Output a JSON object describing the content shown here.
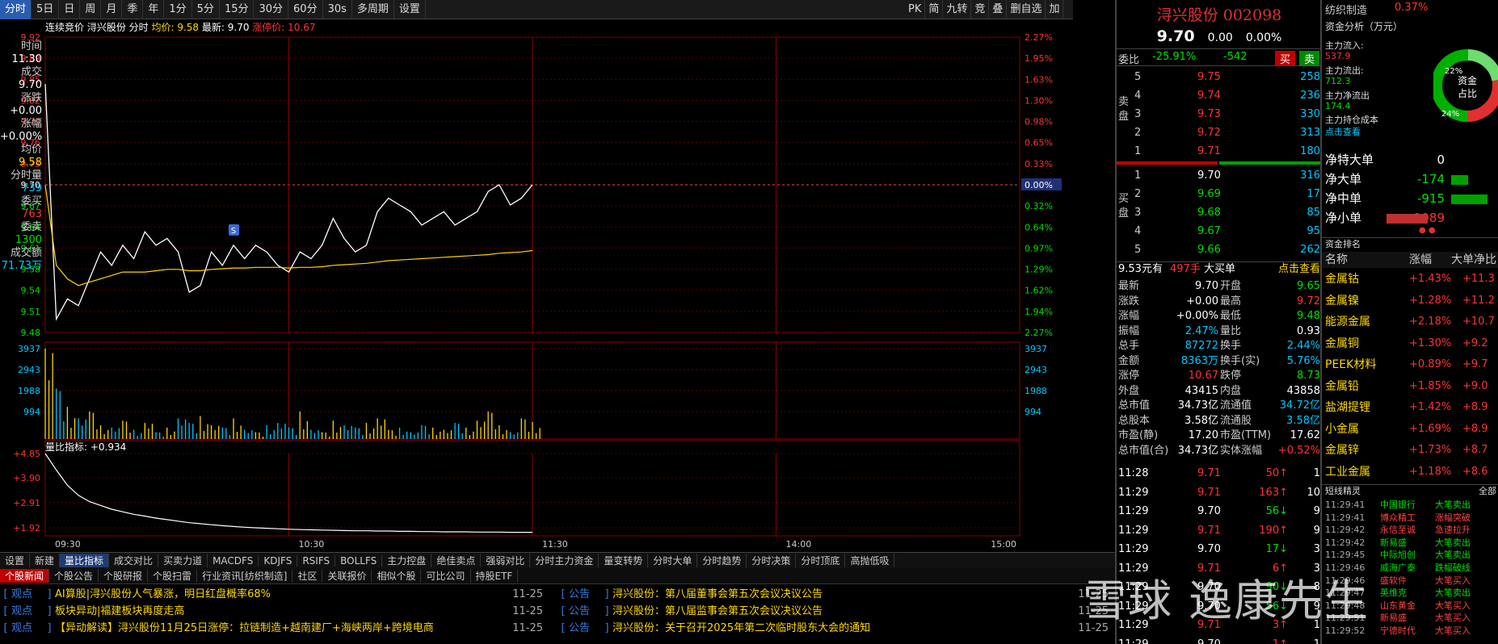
{
  "toolbar": {
    "items": [
      "分时",
      "5日",
      "日",
      "周",
      "月",
      "季",
      "年",
      "1分",
      "5分",
      "15分",
      "30分",
      "60分",
      "30s",
      "多周期",
      "设置"
    ],
    "right_items": [
      "PK",
      "简",
      "九转",
      "竞",
      "叠",
      "删自选",
      "加"
    ]
  },
  "chart_header": {
    "label_auction": "连续竞价",
    "stock": "浔兴股份",
    "mode": "分时",
    "avg_label": "均价: 9.58",
    "last_label": "最新: 9.70",
    "limit_label": "涨停价: 10.67"
  },
  "price_axis": [
    "9.92",
    "9.89",
    "9.85",
    "9.82",
    "9.79",
    "9.76",
    "9.73",
    "9.70",
    "9.67",
    "9.64",
    "9.61",
    "9.58",
    "9.54",
    "9.51",
    "9.48"
  ],
  "pct_axis": [
    "2.27%",
    "1.95%",
    "1.63%",
    "1.30%",
    "0.98%",
    "0.65%",
    "0.33%",
    "0.00%",
    "0.32%",
    "0.64%",
    "0.97%",
    "1.29%",
    "1.62%",
    "1.94%",
    "2.27%"
  ],
  "volume_axis": [
    "3937",
    "2943",
    "1988",
    "994"
  ],
  "liangbi_axis": [
    "+4.85",
    "+3.90",
    "+2.91",
    "+1.92"
  ],
  "liangbi_label": "量比指标: +0.934",
  "time_axis": [
    "09:30",
    "10:30",
    "11:30",
    "14:00",
    "15:00"
  ],
  "left_info": {
    "items": [
      {
        "label": "时间",
        "value": "11:30",
        "color": "#ffffff"
      },
      {
        "label": "成交",
        "value": "9.70",
        "color": "#ffffff"
      },
      {
        "label": "涨跌",
        "value": "+0.00",
        "color": "#ffffff"
      },
      {
        "label": "涨幅",
        "value": "+0.00%",
        "color": "#ffffff"
      },
      {
        "label": "均价",
        "value": "9.58",
        "color": "#ffd700"
      },
      {
        "label": "分时量",
        "value": "739",
        "color": "#00c8ff"
      },
      {
        "label": "委买",
        "value": "763",
        "color": "#ff3333"
      },
      {
        "label": "委卖",
        "value": "1300",
        "color": "#00e000"
      },
      {
        "label": "成交额",
        "value": "71.73万",
        "color": "#00c8ff"
      }
    ]
  },
  "chart_data": {
    "type": "line",
    "title": "浔兴股份 分时",
    "x_labels": [
      "09:30",
      "10:30",
      "11:30",
      "14:00",
      "15:00"
    ],
    "y_range": [
      9.48,
      9.92
    ],
    "pre_close": 9.7,
    "series": [
      {
        "name": "价格",
        "values": [
          9.85,
          9.5,
          9.53,
          9.52,
          9.56,
          9.6,
          9.58,
          9.61,
          9.59,
          9.63,
          9.61,
          9.62,
          9.6,
          9.54,
          9.55,
          9.6,
          9.58,
          9.61,
          9.59,
          9.61,
          9.6,
          9.58,
          9.57,
          9.6,
          9.59,
          9.61,
          9.65,
          9.62,
          9.6,
          9.61,
          9.66,
          9.68,
          9.67,
          9.66,
          9.64,
          9.65,
          9.66,
          9.64,
          9.65,
          9.66,
          9.69,
          9.7,
          9.67,
          9.68,
          9.7
        ]
      },
      {
        "name": "均价",
        "values": [
          9.7,
          9.58,
          9.56,
          9.55,
          9.555,
          9.56,
          9.565,
          9.57,
          9.57,
          9.57,
          9.572,
          9.574,
          9.574,
          9.572,
          9.572,
          9.574,
          9.575,
          9.576,
          9.576,
          9.577,
          9.577,
          9.577,
          9.576,
          9.577,
          9.577,
          9.578,
          9.58,
          9.581,
          9.582,
          9.583,
          9.585,
          9.587,
          9.588,
          9.589,
          9.59,
          9.591,
          9.592,
          9.593,
          9.594,
          9.595,
          9.596,
          9.598,
          9.599,
          9.6,
          9.602
        ]
      },
      {
        "name": "量比",
        "values": [
          4.85,
          4.2,
          3.6,
          3.2,
          2.95,
          2.8,
          2.65,
          2.55,
          2.45,
          2.38,
          2.3,
          2.24,
          2.18,
          2.12,
          2.08,
          2.04,
          2.0,
          1.97,
          1.94,
          1.92,
          1.9,
          1.88,
          1.86,
          1.85,
          1.84,
          1.83,
          1.82,
          1.81,
          1.8,
          1.8,
          1.79,
          1.79,
          1.78,
          1.78,
          1.77,
          1.77,
          1.76,
          1.76,
          1.76,
          1.75,
          1.75,
          1.75,
          1.74,
          1.74,
          1.74
        ]
      }
    ],
    "volumes": [
      3937,
      2200,
      1400,
      900,
      1200,
      600,
      500,
      800,
      400,
      700,
      300,
      500,
      900,
      700,
      1000,
      600,
      500,
      900,
      400,
      300,
      600,
      700,
      500,
      1200,
      400,
      300,
      800,
      600,
      500,
      700,
      900,
      400,
      500,
      300,
      600,
      500,
      400,
      700,
      500,
      800,
      1200,
      600,
      300,
      900,
      739
    ]
  },
  "bottom_tabs": [
    "设置",
    "新建",
    "量比指标",
    "成交对比",
    "买卖力道",
    "MACDFS",
    "KDJFS",
    "RSIFS",
    "BOLLFS",
    "主力控盘",
    "绝佳卖点",
    "强弱对比",
    "分时主力资金",
    "量变转势",
    "分时大单",
    "分时趋势",
    "分时决策",
    "分时顶底",
    "高抛低吸"
  ],
  "news_tabs": [
    "个股新闻",
    "个股公告",
    "个股研报",
    "个股扫雷",
    "行业资讯[纺织制造]",
    "社区",
    "关联报价",
    "相似个股",
    "可比公司",
    "持股ETF"
  ],
  "news_left": [
    {
      "cat": "观点",
      "title": "AI算股|浔兴股份人气暴涨，明日红盘概率68%",
      "date": "11-25"
    },
    {
      "cat": "观点",
      "title": "板块异动|福建板块再度走高",
      "date": "11-25"
    },
    {
      "cat": "观点",
      "title": "【异动解读】浔兴股份11月25日涨停：拉链制造+越南建厂+海峡两岸+跨境电商",
      "date": "11-25"
    }
  ],
  "news_right": [
    {
      "cat": "公告",
      "title": "浔兴股份：第八届董事会第五次会议决议公告",
      "date": "11-25"
    },
    {
      "cat": "公告",
      "title": "浔兴股份：第八届监事会第五次会议决议公告",
      "date": "11-25"
    },
    {
      "cat": "公告",
      "title": "浔兴股份：关于召开2025年第二次临时股东大会的通知",
      "date": "11-25"
    }
  ],
  "quote": {
    "name": "浔兴股份 002098",
    "price": "9.70",
    "change": "0.00",
    "change_pct": "0.00%",
    "weibi_label": "委比",
    "weibi": "-25.91%",
    "weicha": "-542",
    "buy_btn": "买",
    "sell_btn": "卖",
    "sell_label": "卖盘",
    "buy_label": "买盘",
    "asks": [
      {
        "lvl": "5",
        "price": "9.75",
        "vol": "258"
      },
      {
        "lvl": "4",
        "price": "9.74",
        "vol": "236"
      },
      {
        "lvl": "3",
        "price": "9.73",
        "vol": "330"
      },
      {
        "lvl": "2",
        "price": "9.72",
        "vol": "313"
      },
      {
        "lvl": "1",
        "price": "9.71",
        "vol": "180"
      }
    ],
    "bids": [
      {
        "lvl": "1",
        "price": "9.70",
        "vol": "316"
      },
      {
        "lvl": "2",
        "price": "9.69",
        "vol": "17"
      },
      {
        "lvl": "3",
        "price": "9.68",
        "vol": "85"
      },
      {
        "lvl": "4",
        "price": "9.67",
        "vol": "95"
      },
      {
        "lvl": "5",
        "price": "9.66",
        "vol": "262"
      }
    ],
    "big_order": {
      "price": "9.53元有",
      "vol": "497手",
      "label": "大买单",
      "link": "点击查看"
    },
    "stats": [
      [
        "最新",
        "9.70",
        "开盘",
        "9.65"
      ],
      [
        "涨跌",
        "+0.00",
        "最高",
        "9.72"
      ],
      [
        "涨幅",
        "+0.00%",
        "最低",
        "9.48"
      ],
      [
        "振幅",
        "2.47%",
        "量比",
        "0.93"
      ],
      [
        "总手",
        "87272",
        "换手",
        "2.44%"
      ],
      [
        "金额",
        "8363万",
        "换手(实)",
        "5.76%"
      ],
      [
        "涨停",
        "10.67",
        "跌停",
        "8.73"
      ],
      [
        "外盘",
        "43415",
        "内盘",
        "43858"
      ],
      [
        "总市值",
        "34.73亿",
        "流通值",
        "34.72亿"
      ],
      [
        "总股本",
        "3.58亿",
        "流通股",
        "3.58亿"
      ],
      [
        "市盈(静)",
        "17.20",
        "市盈(TTM)",
        "17.62"
      ],
      [
        "总市值(合)",
        "34.73亿",
        "实体涨幅",
        "+0.52%"
      ]
    ],
    "ticks": [
      {
        "time": "11:28",
        "price": "9.71",
        "vol": "50",
        "dir": "↑",
        "n": "1"
      },
      {
        "time": "11:29",
        "price": "9.71",
        "vol": "163",
        "dir": "↑",
        "n": "10"
      },
      {
        "time": "11:29",
        "price": "9.70",
        "vol": "56",
        "dir": "↓",
        "n": "9"
      },
      {
        "time": "11:29",
        "price": "9.71",
        "vol": "190",
        "dir": "↑",
        "n": "9"
      },
      {
        "time": "11:29",
        "price": "9.70",
        "vol": "17",
        "dir": "↓",
        "n": "3"
      },
      {
        "time": "11:29",
        "price": "9.71",
        "vol": "6",
        "dir": "↑",
        "n": "3"
      },
      {
        "time": "11:29",
        "price": "9.70",
        "vol": "90",
        "dir": "↓",
        "n": "8"
      },
      {
        "time": "11:29",
        "price": "9.70",
        "vol": "56",
        "dir": "↓",
        "n": "9"
      },
      {
        "time": "11:29",
        "price": "9.71",
        "vol": "3",
        "dir": "↑",
        "n": "1"
      },
      {
        "time": "11:29",
        "price": "9.70",
        "vol": "1",
        "dir": "↑",
        "n": "1"
      }
    ]
  },
  "fund": {
    "sector": "纺织制造",
    "sector_pct": "0.37%",
    "title": "资金分析（万元）",
    "inflow_label": "主力流入:",
    "inflow": "537.9",
    "outflow_label": "主力流出:",
    "outflow": "712.3",
    "net_label": "主力净流出",
    "net": "174.4",
    "cost_label": "主力持仓成本",
    "cost_link": "点击查看",
    "donut_center": "资金占比",
    "donut_a": "22%",
    "donut_b": "24%",
    "orders": [
      {
        "label": "净特大单",
        "value": "0",
        "bar": 0
      },
      {
        "label": "净大单",
        "value": "-174",
        "bar": -0.35
      },
      {
        "label": "净中单",
        "value": "-915",
        "bar": -0.75
      },
      {
        "label": "净小单",
        "value": "1089",
        "bar": 0.85
      }
    ],
    "rank_title": "资金排名",
    "rank_headers": [
      "名称",
      "涨幅",
      "大单净比"
    ],
    "sectors": [
      {
        "name": "金属钴",
        "pct": "+1.43%",
        "net": "+11.3"
      },
      {
        "name": "金属镍",
        "pct": "+1.28%",
        "net": "+11.2"
      },
      {
        "name": "能源金属",
        "pct": "+2.18%",
        "net": "+10.7"
      },
      {
        "name": "金属铜",
        "pct": "+1.30%",
        "net": "+9.2"
      },
      {
        "name": "PEEK材料",
        "pct": "+0.89%",
        "net": "+9.7"
      },
      {
        "name": "金属铅",
        "pct": "+1.85%",
        "net": "+9.0"
      },
      {
        "name": "盐湖提锂",
        "pct": "+1.42%",
        "net": "+8.9"
      },
      {
        "name": "小金属",
        "pct": "+1.69%",
        "net": "+8.9"
      },
      {
        "name": "金属锌",
        "pct": "+1.73%",
        "net": "+8.7"
      },
      {
        "name": "工业金属",
        "pct": "+1.18%",
        "net": "+8.6"
      }
    ],
    "short_title": "短线精灵",
    "short_all": "全部",
    "short_items": [
      {
        "time": "11:29:41",
        "name": "中国银行",
        "evt": "大笔卖出"
      },
      {
        "time": "11:29:41",
        "name": "博众精工",
        "evt": "涨幅突破"
      },
      {
        "time": "11:29:42",
        "name": "永信至诚",
        "evt": "急速拉升"
      },
      {
        "time": "11:29:42",
        "name": "新易盛",
        "evt": "大笔卖出"
      },
      {
        "time": "11:29:45",
        "name": "中际旭创",
        "evt": "大笔卖出"
      },
      {
        "time": "11:29:46",
        "name": "威海广泰",
        "evt": "跌幅破线"
      },
      {
        "time": "11:29:46",
        "name": "盛软件",
        "evt": "大笔买入"
      },
      {
        "time": "11:29:47",
        "name": "英维克",
        "evt": "大笔卖出"
      },
      {
        "time": "11:29:48",
        "name": "山东黄金",
        "evt": "大笔买入"
      },
      {
        "time": "11:29:51",
        "name": "新易盛",
        "evt": "大笔买入"
      },
      {
        "time": "11:29:52",
        "name": "宁德时代",
        "evt": "大笔买入"
      }
    ]
  },
  "watermark": "雪球 逸康先生"
}
